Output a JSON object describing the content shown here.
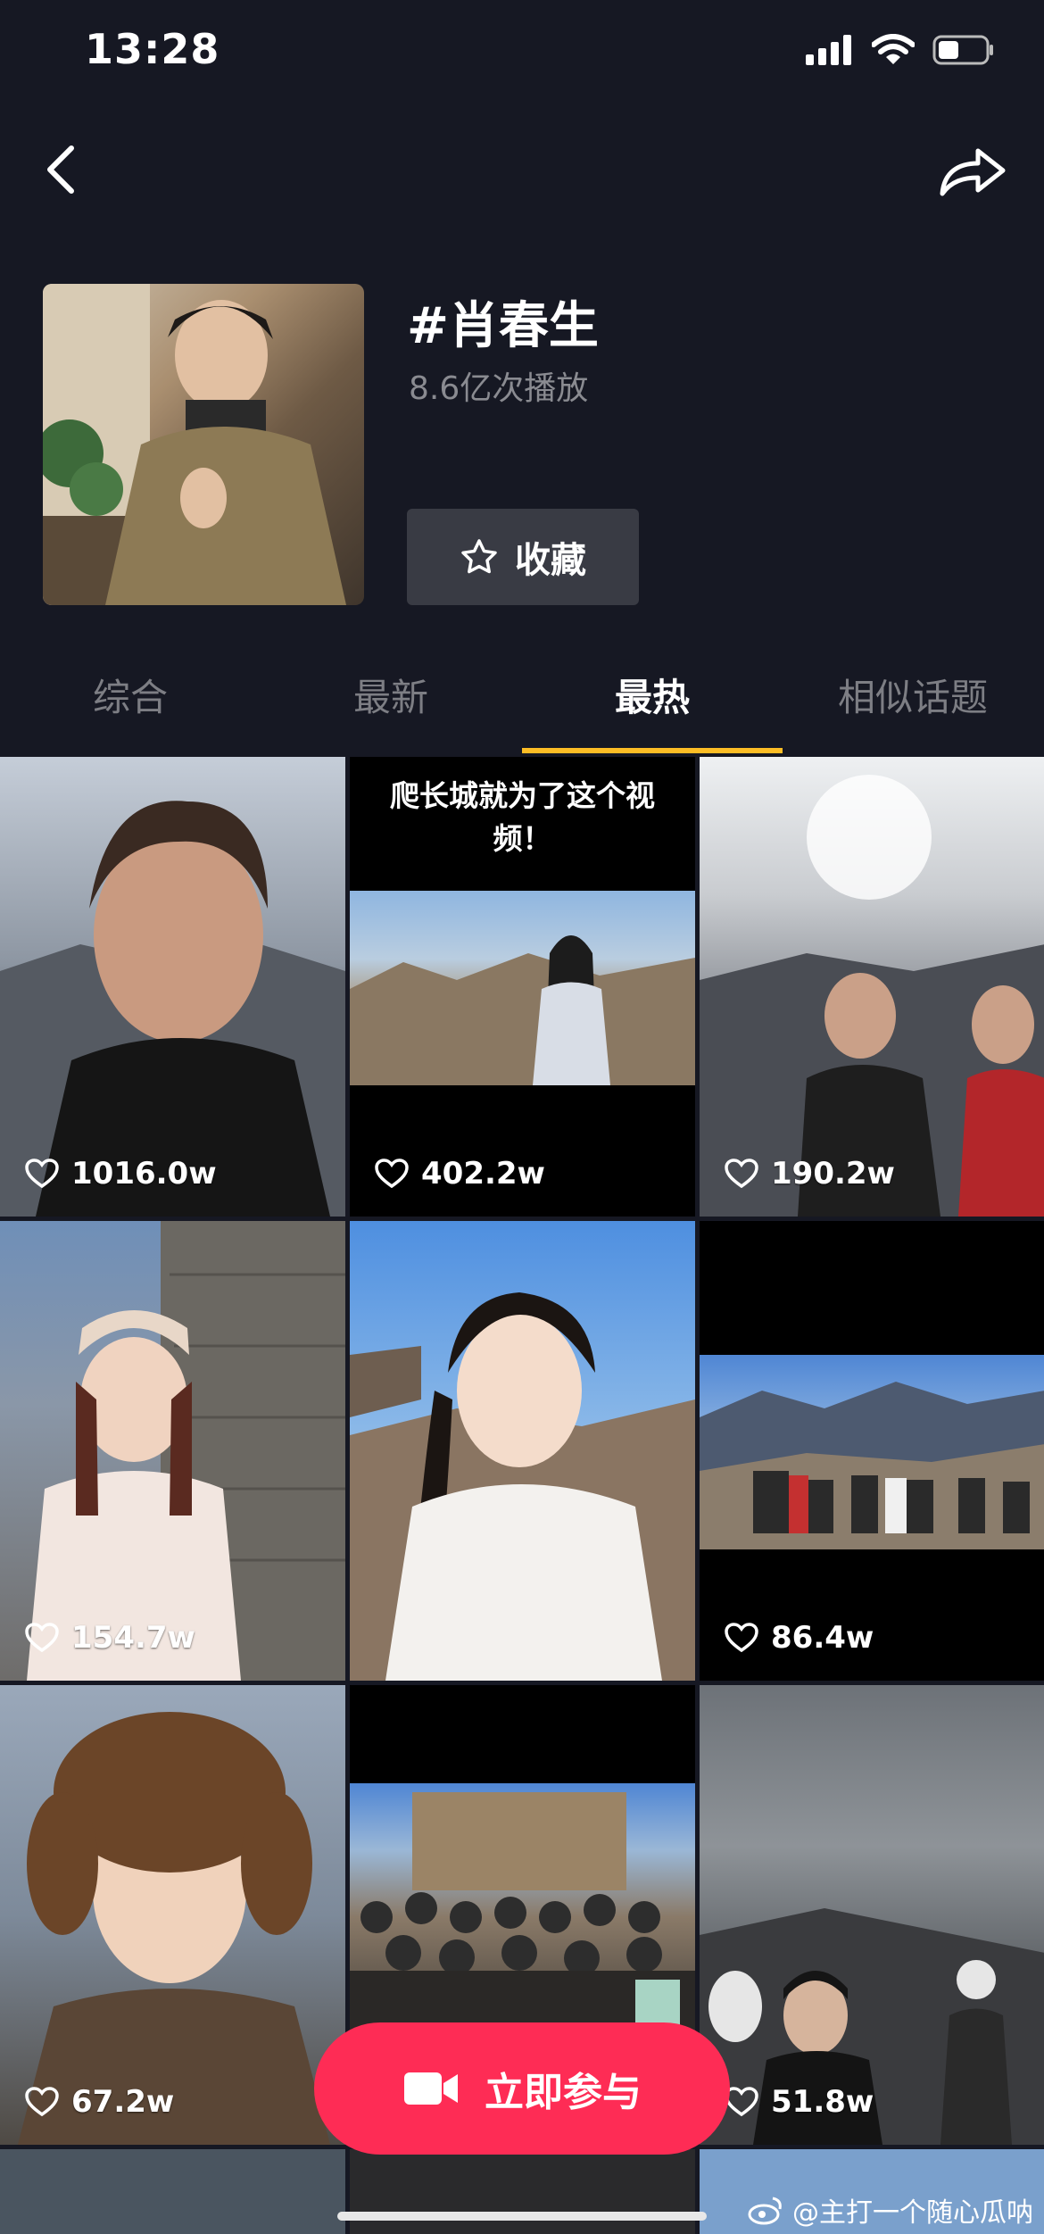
{
  "status_bar": {
    "time": "13:28",
    "icons": [
      "signal-icon",
      "wifi-icon",
      "battery-icon"
    ]
  },
  "nav": {
    "back_icon": "back-arrow-icon",
    "share_icon": "share-icon"
  },
  "topic": {
    "title": "#肖春生",
    "plays": "8.6亿次播放",
    "favorite_label": "收藏",
    "favorite_icon": "star-icon"
  },
  "tabs": [
    {
      "label": "综合",
      "active": false
    },
    {
      "label": "最新",
      "active": false
    },
    {
      "label": "最热",
      "active": true
    },
    {
      "label": "相似话题",
      "active": false
    }
  ],
  "videos": [
    {
      "likes": "1016.0w",
      "caption": ""
    },
    {
      "likes": "402.2w",
      "caption": "爬长城就为了这个视频！"
    },
    {
      "likes": "190.2w",
      "caption": ""
    },
    {
      "likes": "154.7w",
      "caption": ""
    },
    {
      "likes": "",
      "caption": ""
    },
    {
      "likes": "86.4w",
      "caption": ""
    },
    {
      "likes": "67.2w",
      "caption": ""
    },
    {
      "likes": "",
      "caption": ""
    },
    {
      "likes": "51.8w",
      "caption": ""
    }
  ],
  "join_button": {
    "label": "立即参与",
    "icon": "video-camera-icon"
  },
  "watermark": {
    "text": "@主打一个随心瓜呐",
    "icon": "weibo-icon"
  },
  "colors": {
    "background": "#161823",
    "accent": "#fe2c55",
    "tab_indicator": "#fcbd25",
    "secondary_text": "#8a8b91"
  }
}
